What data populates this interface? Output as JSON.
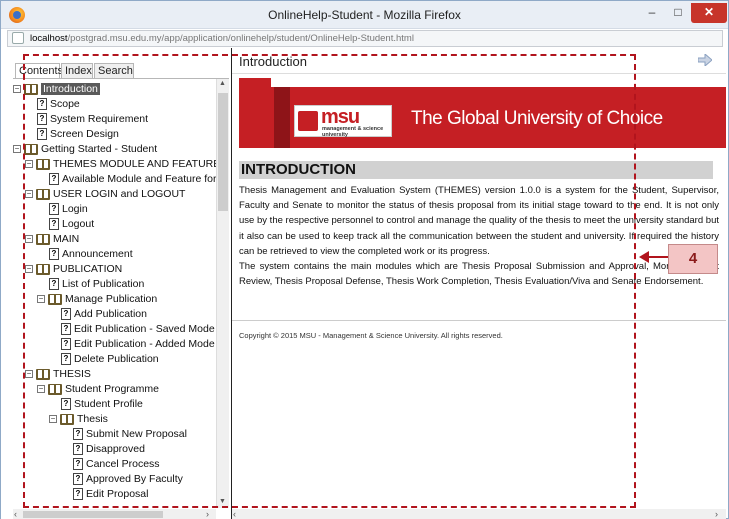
{
  "window": {
    "title": "OnlineHelp-Student - Mozilla Firefox",
    "min_label": "–",
    "max_label": "□",
    "close_label": "✕"
  },
  "urlbar": {
    "host": "localhost",
    "path": "/postgrad.msu.edu.my/app/application/onlinehelp/student/OnlineHelp-Student.html"
  },
  "tabs": [
    "Contents",
    "Index",
    "Search"
  ],
  "tree": [
    {
      "label": "Introduction",
      "type": "book",
      "expander": "−",
      "selected": true
    },
    {
      "label": "Scope",
      "type": "page"
    },
    {
      "label": "System Requirement",
      "type": "page"
    },
    {
      "label": "Screen Design",
      "type": "page"
    },
    {
      "label": "Getting Started - Student",
      "type": "book",
      "expander": "−"
    },
    {
      "label": "THEMES MODULE AND FEATURE",
      "type": "book",
      "expander": "−"
    },
    {
      "label": "Available Module and Feature for S",
      "type": "page"
    },
    {
      "label": "USER LOGIN and LOGOUT",
      "type": "book",
      "expander": "−"
    },
    {
      "label": "Login",
      "type": "page"
    },
    {
      "label": "Logout",
      "type": "page"
    },
    {
      "label": "MAIN",
      "type": "book",
      "expander": "−"
    },
    {
      "label": "Announcement",
      "type": "page"
    },
    {
      "label": "PUBLICATION",
      "type": "book",
      "expander": "−"
    },
    {
      "label": "List of Publication",
      "type": "page"
    },
    {
      "label": "Manage Publication",
      "type": "book",
      "expander": "−"
    },
    {
      "label": "Add Publication",
      "type": "page"
    },
    {
      "label": "Edit Publication - Saved Mode",
      "type": "page"
    },
    {
      "label": "Edit Publication - Added Mode",
      "type": "page"
    },
    {
      "label": "Delete Publication",
      "type": "page"
    },
    {
      "label": "THESIS",
      "type": "book",
      "expander": "−"
    },
    {
      "label": "Student Programme",
      "type": "book",
      "expander": "−"
    },
    {
      "label": "Student Profile",
      "type": "page"
    },
    {
      "label": "Thesis",
      "type": "book",
      "expander": "−"
    },
    {
      "label": "Submit New Proposal",
      "type": "page"
    },
    {
      "label": "Disapproved",
      "type": "page"
    },
    {
      "label": "Cancel Process",
      "type": "page"
    },
    {
      "label": "Approved By Faculty",
      "type": "page"
    },
    {
      "label": "Edit Proposal",
      "type": "page"
    }
  ],
  "content": {
    "header": "Introduction",
    "logo_name": "msu",
    "logo_sub": "management & science university",
    "slogan": "The Global University of Choice",
    "section_title": "INTRODUCTION",
    "para1": "Thesis Management and Evaluation System (THEMES) version 1.0.0 is a system for the Student, Supervisor, Faculty and Senate to monitor the status of thesis proposal from its initial stage toward to the end. It is not only use by the respective personnel to control and manage the quality of the thesis to meet the university standard but it also can be used to keep track all the communication between the student and university. If required the history can be retrieved to view the completed work or its progress.",
    "para2": "The system contains the main modules which are Thesis Proposal Submission and Approval, Monthly Report Review, Thesis Proposal Defense, Thesis Work Completion, Thesis Evaluation/Viva and Senate Endorsement.",
    "copyright": "Copyright © 2015 MSU - Management & Science University. All rights reserved."
  },
  "callout": {
    "number": "4"
  },
  "colors": {
    "accent_red": "#c51f24",
    "annotation": "#b1141d",
    "callout_bg": "#f3c5c5"
  }
}
